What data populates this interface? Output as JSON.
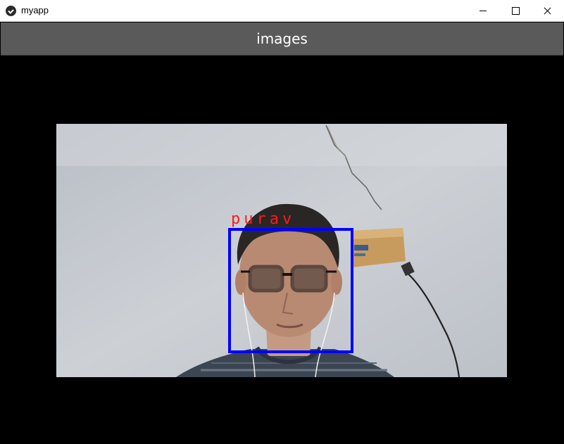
{
  "window": {
    "title": "myapp",
    "icon": "kivy-icon"
  },
  "header": {
    "title": "images"
  },
  "camera": {
    "detection_label": "purav"
  },
  "colors": {
    "header_bg": "#5a5a5a",
    "box": "#0000ff",
    "label": "#ff1a1a"
  }
}
